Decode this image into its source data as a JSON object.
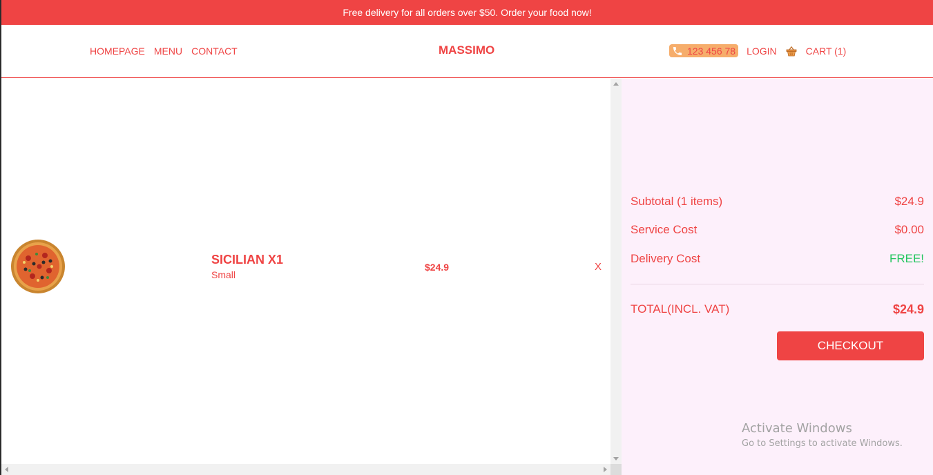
{
  "announcement": "Free delivery for all orders over $50. Order your food now!",
  "nav": {
    "links": [
      "HOMEPAGE",
      "MENU",
      "CONTACT"
    ],
    "brand": "MASSIMO",
    "phone": "123 456 78",
    "login": "LOGIN",
    "cart": "CART (1)"
  },
  "cart": {
    "items": [
      {
        "name": "SICILIAN X1",
        "size": "Small",
        "price": "$24.9",
        "remove": "X"
      }
    ]
  },
  "summary": {
    "subtotal_label": "Subtotal (1 items)",
    "subtotal_value": "$24.9",
    "service_label": "Service Cost",
    "service_value": "$0.00",
    "delivery_label": "Delivery Cost",
    "delivery_value": "FREE!",
    "total_label": "TOTAL(INCL. VAT)",
    "total_value": "$24.9",
    "checkout": "CHECKOUT"
  },
  "watermark": {
    "title": "Activate Windows",
    "subtitle": "Go to Settings to activate Windows."
  },
  "colors": {
    "accent": "#ef4444",
    "phone_bg": "#f6ad6b",
    "summary_bg": "#fdf0fb",
    "free_text": "#22c55e"
  },
  "icons": [
    "phone-icon",
    "basket-icon",
    "pizza-image"
  ]
}
